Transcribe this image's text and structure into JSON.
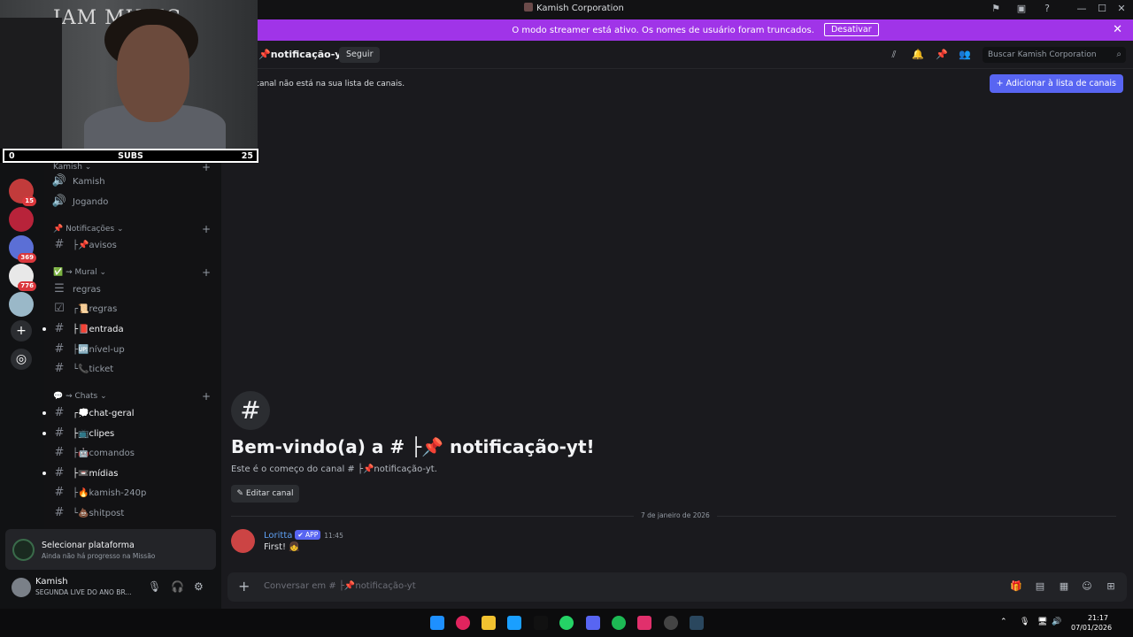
{
  "window": {
    "title": "Kamish Corporation"
  },
  "streamer_bar": {
    "message": "O modo streamer está ativo. Os nomes de usuário foram truncados.",
    "disable_label": "Desativar"
  },
  "header": {
    "channel_name": "📌notificação-yt",
    "follow_label": "Seguir",
    "search_placeholder": "Buscar Kamish Corporation"
  },
  "notice": {
    "text": "canal não está na sua lista de canais.",
    "add_label": "+ Adicionar à lista de canais"
  },
  "webcam": {
    "sign_text": "IAM MUSIC",
    "subs_left": "0",
    "subs_label": "SUBS",
    "subs_right": "25"
  },
  "guilds": [
    {
      "badge": "15",
      "color": "#c23b3b"
    },
    {
      "badge": "",
      "color": "#b8233a"
    },
    {
      "badge": "369",
      "color": "#5b6fd6"
    },
    {
      "badge": "776",
      "color": "#e8e8e8"
    },
    {
      "badge": "",
      "color": "#9ab8c8"
    }
  ],
  "channels": {
    "top_category": "Kamish",
    "voice": [
      "Kamish",
      "Jogando"
    ],
    "categories": [
      {
        "name": "📌 Notificações",
        "items": [
          "├📌avisos"
        ]
      },
      {
        "name": "✅ ⇝ Mural",
        "items": [
          "regras",
          "┌📜regras",
          "├📕entrada",
          "├🆙nível-up",
          "└📞ticket"
        ]
      },
      {
        "name": "💬 ⇝ Chats",
        "items": [
          "┌💭chat-geral",
          "├📺clipes",
          "├🤖comandos",
          "├📼mídias",
          "├🔥kamish-240p",
          "└💩shitpost"
        ]
      }
    ]
  },
  "mission": {
    "title": "Selecionar plataforma",
    "subtitle": "Ainda não há progresso na Missão"
  },
  "user": {
    "name": "Kamish",
    "status": "SEGUNDA LIVE DO ANO BR..."
  },
  "welcome": {
    "title": "Bem-vindo(a) a # ├📌 notificação-yt!",
    "subtitle": "Este é o começo do canal # ├📌notificação-yt.",
    "edit_label": "Editar canal"
  },
  "divider_date": "7 de janeiro de 2026",
  "message": {
    "author": "Loritta",
    "tag": "✔ APP",
    "time": "11:45",
    "text": "First! 👧"
  },
  "composer": {
    "placeholder": "Conversar em # ├📌notificação-yt"
  },
  "taskbar": {
    "time": "21:17",
    "date": "07/01/2026"
  }
}
